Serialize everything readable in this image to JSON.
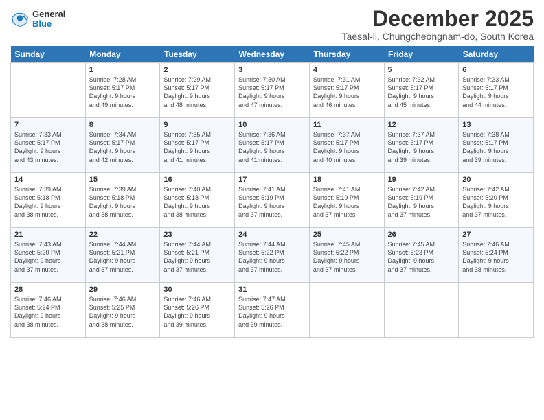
{
  "header": {
    "logo_general": "General",
    "logo_blue": "Blue",
    "month": "December 2025",
    "location": "Taesal-li, Chungcheongnam-do, South Korea"
  },
  "days": [
    "Sunday",
    "Monday",
    "Tuesday",
    "Wednesday",
    "Thursday",
    "Friday",
    "Saturday"
  ],
  "weeks": [
    [
      {
        "day": "",
        "info": ""
      },
      {
        "day": "1",
        "info": "Sunrise: 7:28 AM\nSunset: 5:17 PM\nDaylight: 9 hours\nand 49 minutes."
      },
      {
        "day": "2",
        "info": "Sunrise: 7:29 AM\nSunset: 5:17 PM\nDaylight: 9 hours\nand 48 minutes."
      },
      {
        "day": "3",
        "info": "Sunrise: 7:30 AM\nSunset: 5:17 PM\nDaylight: 9 hours\nand 47 minutes."
      },
      {
        "day": "4",
        "info": "Sunrise: 7:31 AM\nSunset: 5:17 PM\nDaylight: 9 hours\nand 46 minutes."
      },
      {
        "day": "5",
        "info": "Sunrise: 7:32 AM\nSunset: 5:17 PM\nDaylight: 9 hours\nand 45 minutes."
      },
      {
        "day": "6",
        "info": "Sunrise: 7:33 AM\nSunset: 5:17 PM\nDaylight: 9 hours\nand 44 minutes."
      }
    ],
    [
      {
        "day": "7",
        "info": "Sunrise: 7:33 AM\nSunset: 5:17 PM\nDaylight: 9 hours\nand 43 minutes."
      },
      {
        "day": "8",
        "info": "Sunrise: 7:34 AM\nSunset: 5:17 PM\nDaylight: 9 hours\nand 42 minutes."
      },
      {
        "day": "9",
        "info": "Sunrise: 7:35 AM\nSunset: 5:17 PM\nDaylight: 9 hours\nand 41 minutes."
      },
      {
        "day": "10",
        "info": "Sunrise: 7:36 AM\nSunset: 5:17 PM\nDaylight: 9 hours\nand 41 minutes."
      },
      {
        "day": "11",
        "info": "Sunrise: 7:37 AM\nSunset: 5:17 PM\nDaylight: 9 hours\nand 40 minutes."
      },
      {
        "day": "12",
        "info": "Sunrise: 7:37 AM\nSunset: 5:17 PM\nDaylight: 9 hours\nand 39 minutes."
      },
      {
        "day": "13",
        "info": "Sunrise: 7:38 AM\nSunset: 5:17 PM\nDaylight: 9 hours\nand 39 minutes."
      }
    ],
    [
      {
        "day": "14",
        "info": "Sunrise: 7:39 AM\nSunset: 5:18 PM\nDaylight: 9 hours\nand 38 minutes."
      },
      {
        "day": "15",
        "info": "Sunrise: 7:39 AM\nSunset: 5:18 PM\nDaylight: 9 hours\nand 38 minutes."
      },
      {
        "day": "16",
        "info": "Sunrise: 7:40 AM\nSunset: 5:18 PM\nDaylight: 9 hours\nand 38 minutes."
      },
      {
        "day": "17",
        "info": "Sunrise: 7:41 AM\nSunset: 5:19 PM\nDaylight: 9 hours\nand 37 minutes."
      },
      {
        "day": "18",
        "info": "Sunrise: 7:41 AM\nSunset: 5:19 PM\nDaylight: 9 hours\nand 37 minutes."
      },
      {
        "day": "19",
        "info": "Sunrise: 7:42 AM\nSunset: 5:19 PM\nDaylight: 9 hours\nand 37 minutes."
      },
      {
        "day": "20",
        "info": "Sunrise: 7:42 AM\nSunset: 5:20 PM\nDaylight: 9 hours\nand 37 minutes."
      }
    ],
    [
      {
        "day": "21",
        "info": "Sunrise: 7:43 AM\nSunset: 5:20 PM\nDaylight: 9 hours\nand 37 minutes."
      },
      {
        "day": "22",
        "info": "Sunrise: 7:44 AM\nSunset: 5:21 PM\nDaylight: 9 hours\nand 37 minutes."
      },
      {
        "day": "23",
        "info": "Sunrise: 7:44 AM\nSunset: 5:21 PM\nDaylight: 9 hours\nand 37 minutes."
      },
      {
        "day": "24",
        "info": "Sunrise: 7:44 AM\nSunset: 5:22 PM\nDaylight: 9 hours\nand 37 minutes."
      },
      {
        "day": "25",
        "info": "Sunrise: 7:45 AM\nSunset: 5:22 PM\nDaylight: 9 hours\nand 37 minutes."
      },
      {
        "day": "26",
        "info": "Sunrise: 7:45 AM\nSunset: 5:23 PM\nDaylight: 9 hours\nand 37 minutes."
      },
      {
        "day": "27",
        "info": "Sunrise: 7:46 AM\nSunset: 5:24 PM\nDaylight: 9 hours\nand 38 minutes."
      }
    ],
    [
      {
        "day": "28",
        "info": "Sunrise: 7:46 AM\nSunset: 5:24 PM\nDaylight: 9 hours\nand 38 minutes."
      },
      {
        "day": "29",
        "info": "Sunrise: 7:46 AM\nSunset: 5:25 PM\nDaylight: 9 hours\nand 38 minutes."
      },
      {
        "day": "30",
        "info": "Sunrise: 7:46 AM\nSunset: 5:26 PM\nDaylight: 9 hours\nand 39 minutes."
      },
      {
        "day": "31",
        "info": "Sunrise: 7:47 AM\nSunset: 5:26 PM\nDaylight: 9 hours\nand 39 minutes."
      },
      {
        "day": "",
        "info": ""
      },
      {
        "day": "",
        "info": ""
      },
      {
        "day": "",
        "info": ""
      }
    ]
  ]
}
